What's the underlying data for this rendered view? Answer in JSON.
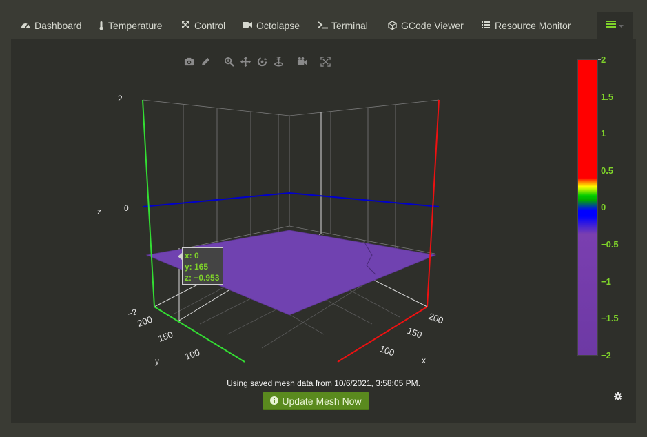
{
  "tabs": [
    {
      "label": "Dashboard",
      "icon": "dashboard-icon"
    },
    {
      "label": "Temperature",
      "icon": "thermometer-icon"
    },
    {
      "label": "Control",
      "icon": "arrows-icon"
    },
    {
      "label": "Octolapse",
      "icon": "video-camera-icon"
    },
    {
      "label": "Terminal",
      "icon": "terminal-icon"
    },
    {
      "label": "GCode Viewer",
      "icon": "cube-icon"
    },
    {
      "label": "Resource Monitor",
      "icon": "list-icon"
    }
  ],
  "toolbar": [
    "camera-icon",
    "pencil-icon",
    "zoom-icon",
    "pan-icon",
    "orbit-icon",
    "turntable-icon",
    "reset-camera-icon",
    "autoscale-icon"
  ],
  "axis": {
    "z_title": "z",
    "y_title": "y",
    "x_title": "x",
    "z_ticks": [
      "2",
      "0",
      "−2"
    ],
    "y_ticks": [
      "200",
      "150",
      "100"
    ],
    "x_ticks": [
      "200",
      "150",
      "100"
    ]
  },
  "tooltip": {
    "x": "x: 0",
    "y": "y: 165",
    "z": "z: −0.953"
  },
  "colorbar": {
    "ticks": [
      "2",
      "1.5",
      "1",
      "0.5",
      "0",
      "−0.5",
      "−1",
      "−1.5",
      "−2"
    ],
    "colors": {
      "high": "#ff0000",
      "mid": "#00cc00",
      "zero": "#0000ff",
      "low": "#6d39a4"
    }
  },
  "info": {
    "text": "Using saved mesh data from 10/6/2021, 3:58:05 PM."
  },
  "update_button": {
    "label": "Update Mesh Now"
  },
  "colors": {
    "accent": "#5a8a1e",
    "label_green": "#7fd32a",
    "mesh": "#7042b0"
  }
}
